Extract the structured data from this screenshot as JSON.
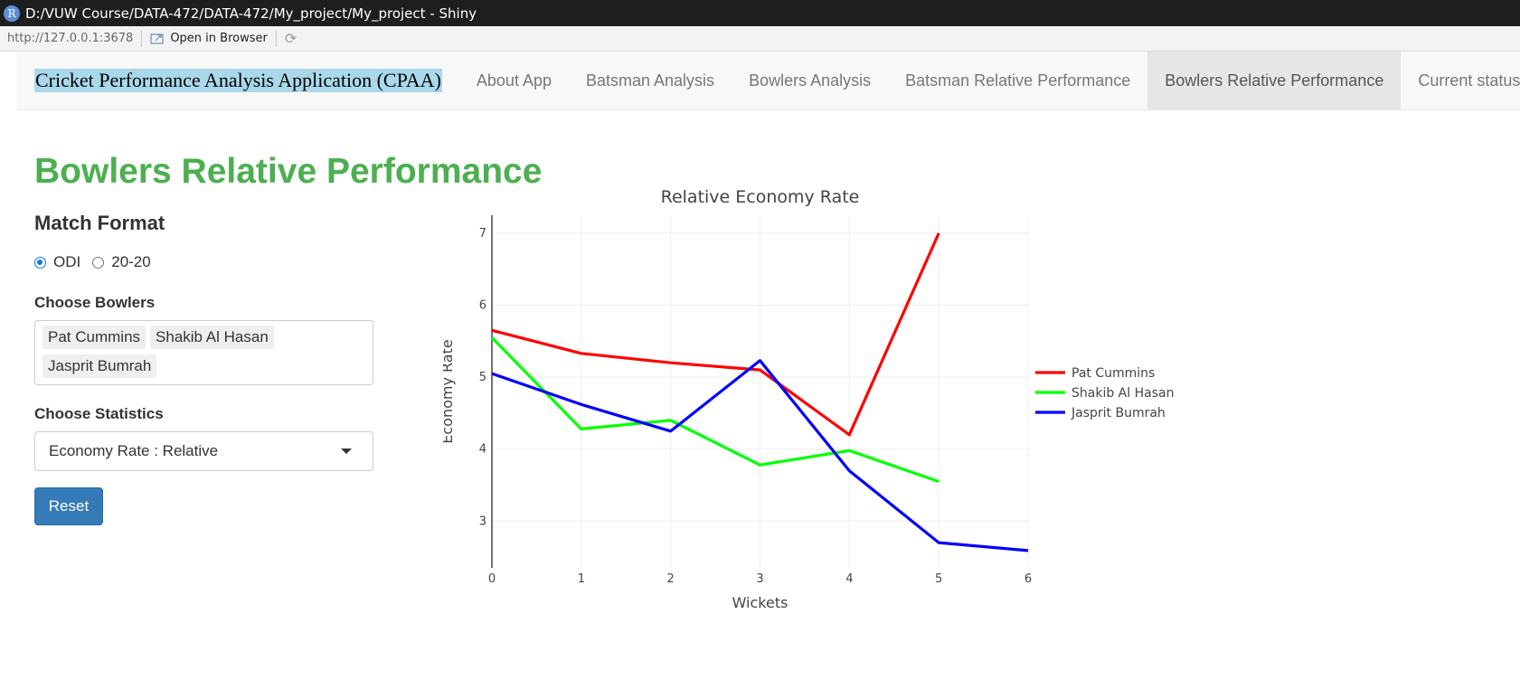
{
  "window": {
    "title": "D:/VUW Course/DATA-472/DATA-472/My_project/My_project - Shiny",
    "logo_letter": "R"
  },
  "toolbar": {
    "url": "http://127.0.0.1:3678",
    "open_in_browser": "Open in Browser"
  },
  "navbar": {
    "brand": "Cricket Performance Analysis Application (CPAA)",
    "tabs": [
      {
        "label": "About App",
        "active": false
      },
      {
        "label": "Batsman Analysis",
        "active": false
      },
      {
        "label": "Bowlers Analysis",
        "active": false
      },
      {
        "label": "Batsman Relative Performance",
        "active": false
      },
      {
        "label": "Bowlers Relative Performance",
        "active": true
      },
      {
        "label": "Current status",
        "active": false
      }
    ]
  },
  "page": {
    "title": "Bowlers Relative Performance"
  },
  "sidebar": {
    "match_format": {
      "label": "Match Format",
      "options": [
        {
          "label": "ODI",
          "checked": true
        },
        {
          "label": "20-20",
          "checked": false
        }
      ]
    },
    "bowlers": {
      "label": "Choose Bowlers",
      "selected": [
        "Pat Cummins",
        "Shakib Al Hasan",
        "Jasprit Bumrah"
      ]
    },
    "statistics": {
      "label": "Choose Statistics",
      "value": "Economy Rate : Relative"
    },
    "reset_label": "Reset"
  },
  "chart_data": {
    "type": "line",
    "title": "Relative Economy Rate",
    "xlabel": "Wickets",
    "ylabel": "Economy Rate",
    "xlim": [
      0,
      6
    ],
    "ylim": [
      2.35,
      7.25
    ],
    "xticks": [
      0,
      1,
      2,
      3,
      4,
      5,
      6
    ],
    "yticks": [
      3,
      4,
      5,
      6,
      7
    ],
    "grid": true,
    "legend": "right",
    "series": [
      {
        "name": "Pat Cummins",
        "color": "#ff0000",
        "x": [
          0,
          1,
          2,
          3,
          4,
          5
        ],
        "y": [
          5.65,
          5.33,
          5.2,
          5.1,
          4.2,
          7.0
        ]
      },
      {
        "name": "Shakib Al Hasan",
        "color": "#00ff00",
        "x": [
          0,
          1,
          2,
          3,
          4,
          5
        ],
        "y": [
          5.55,
          4.28,
          4.4,
          3.78,
          3.98,
          3.55
        ]
      },
      {
        "name": "Jasprit Bumrah",
        "color": "#0000ff",
        "x": [
          0,
          1,
          2,
          3,
          4,
          5,
          6
        ],
        "y": [
          5.05,
          4.62,
          4.25,
          5.23,
          3.7,
          2.7,
          2.59
        ]
      }
    ]
  }
}
